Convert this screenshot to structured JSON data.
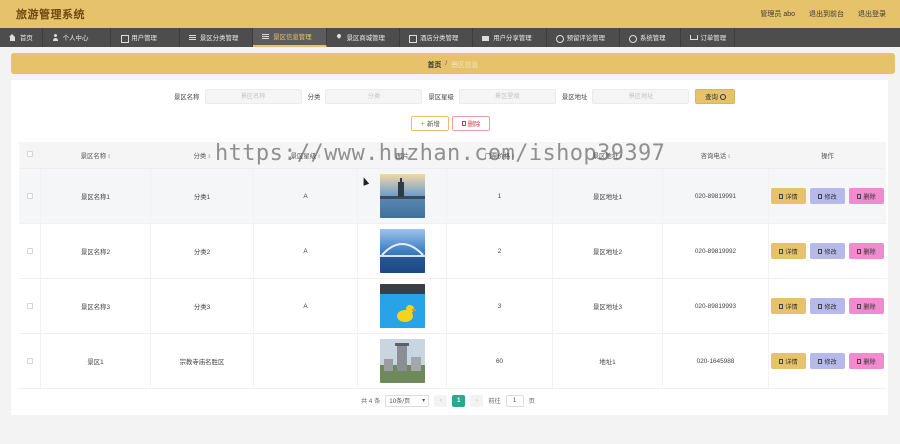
{
  "header": {
    "title": "旅游管理系统",
    "admin": "管理员 abo",
    "exit_to_front": "退出到前台",
    "logout": "退出登录"
  },
  "nav": {
    "items": [
      {
        "label": "首页",
        "icon": "home-icon"
      },
      {
        "label": "个人中心",
        "icon": "user-icon"
      },
      {
        "label": "用户管理",
        "icon": "box-icon"
      },
      {
        "label": "景区分类管理",
        "icon": "lines-icon"
      },
      {
        "label": "景区信息管理",
        "icon": "lines-icon",
        "active": true
      },
      {
        "label": "景区商城管理",
        "icon": "pin-icon"
      },
      {
        "label": "酒店分类管理",
        "icon": "box-icon"
      },
      {
        "label": "用户分享管理",
        "icon": "folder-icon"
      },
      {
        "label": "预留评论管理",
        "icon": "circle-icon"
      },
      {
        "label": "系统管理",
        "icon": "circle-icon"
      },
      {
        "label": "订单管理",
        "icon": "cart-icon"
      }
    ]
  },
  "breadcrumb": {
    "home": "首页",
    "separator": "/",
    "current": "景区信息"
  },
  "search": {
    "name_label": "景区名称",
    "name_placeholder": "景区名称",
    "category_label": "分类",
    "category_placeholder": "分类",
    "level_label": "景区星级",
    "level_placeholder": "景区星级",
    "address_label": "景区地址",
    "address_placeholder": "景区地址",
    "button": "查询"
  },
  "actions": {
    "add": "新增",
    "delete": "删除"
  },
  "table": {
    "columns": [
      "景区名称",
      "分类",
      "景区星级",
      "图片",
      "门票价格",
      "景区地址",
      "咨询电话",
      "操作"
    ],
    "rows": [
      {
        "name": "景区名称1",
        "category": "分类1",
        "level": "A",
        "price": "1",
        "address": "景区地址1",
        "phone": "020-89819991",
        "image": "sunset-lake"
      },
      {
        "name": "景区名称2",
        "category": "分类2",
        "level": "A",
        "price": "2",
        "address": "景区地址2",
        "phone": "020-89819992",
        "image": "bridge-night"
      },
      {
        "name": "景区名称3",
        "category": "分类3",
        "level": "A",
        "price": "3",
        "address": "景区地址3",
        "phone": "020-89819993",
        "image": "pool-duck"
      },
      {
        "name": "景区1",
        "category": "宗教寺庙名胜区",
        "level": "",
        "price": "60",
        "address": "地址1",
        "phone": "020-1645988",
        "image": "temple-tower"
      }
    ],
    "op_detail": "详情",
    "op_edit": "修改",
    "op_delete": "删除"
  },
  "pagination": {
    "total": "共 4 条",
    "page_size": "10条/页",
    "current_page": "1",
    "goto_label": "前往",
    "goto_value": "1",
    "page_suffix": "页"
  },
  "watermark": "https://www.huzhan.com/ishop39397",
  "colors": {
    "brand": "#e6c36b",
    "nav_bg": "#4d4d4d",
    "edit": "#b6b9ea",
    "delete": "#f08bcf",
    "page_active": "#2ca88f"
  }
}
